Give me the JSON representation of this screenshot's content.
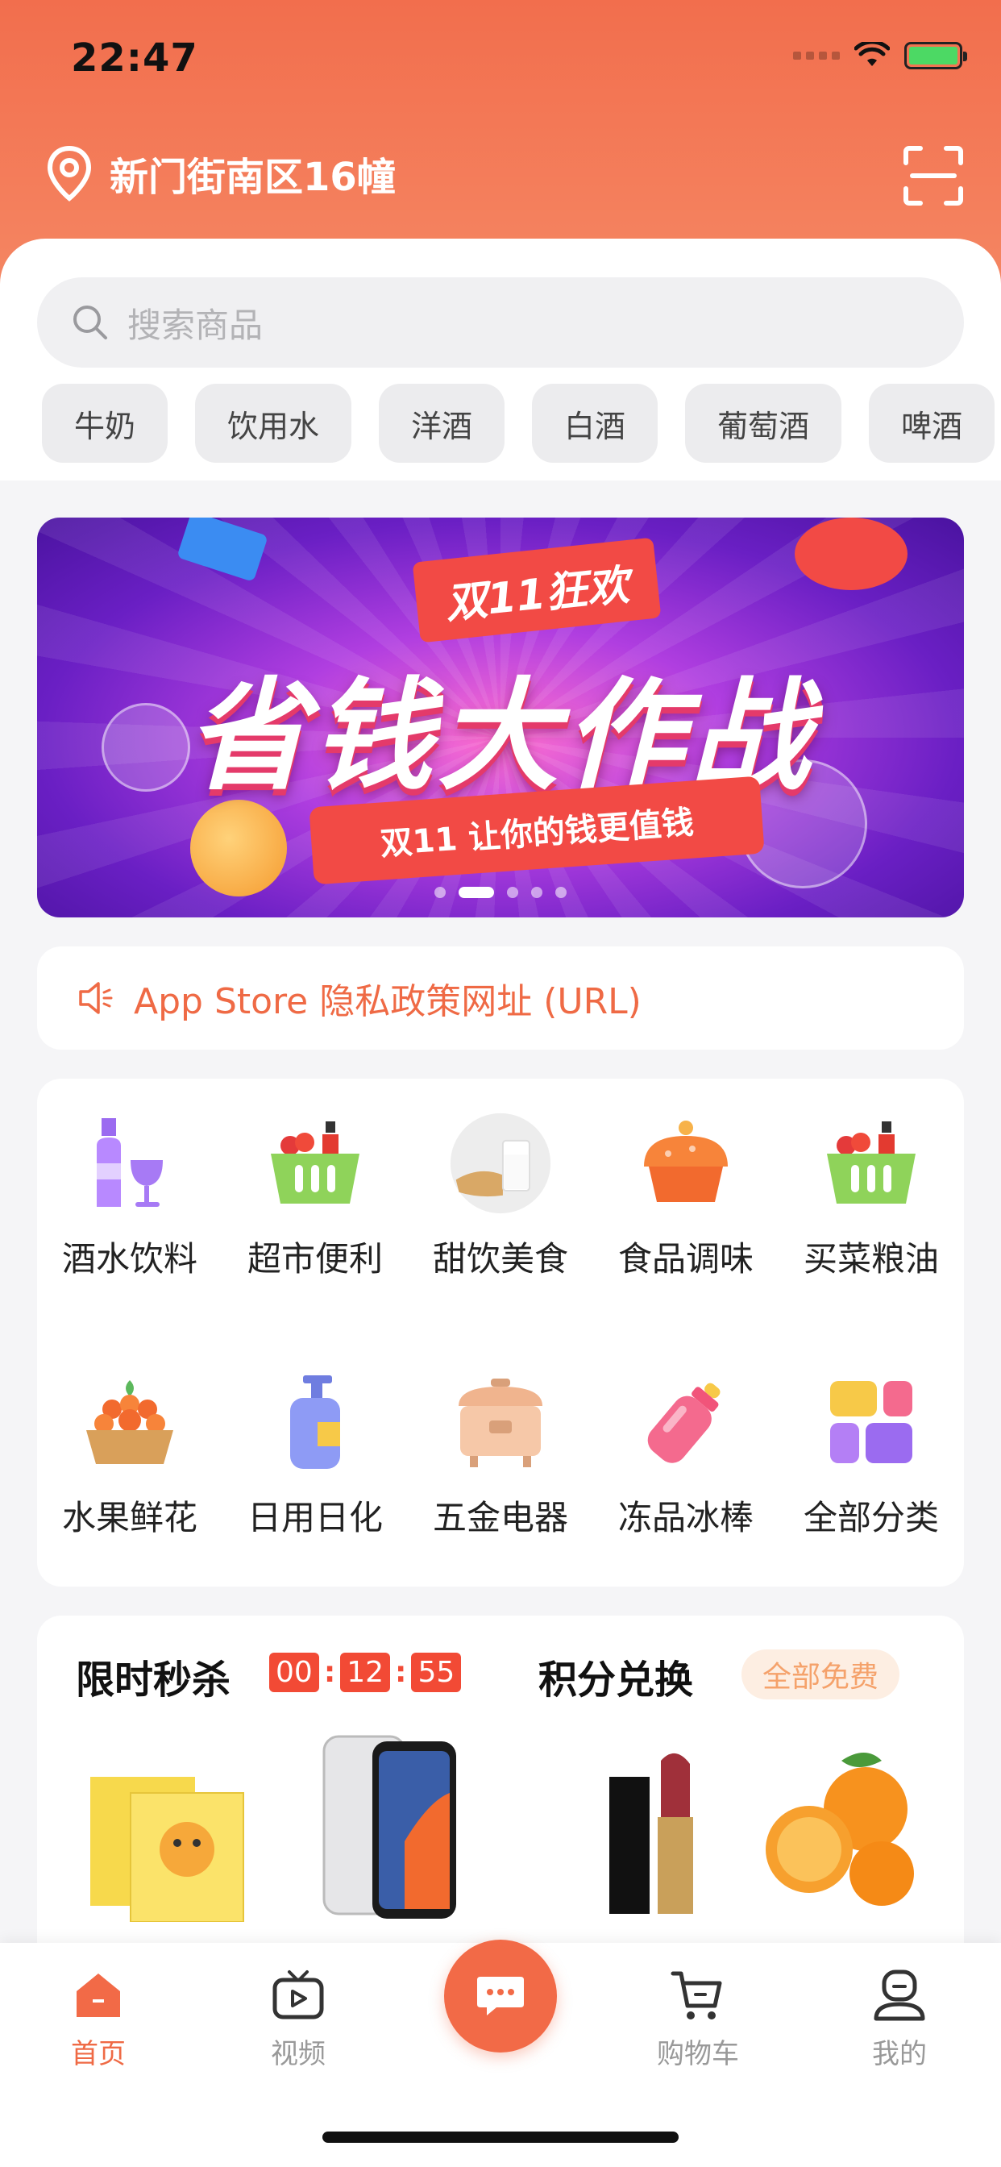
{
  "status_bar": {
    "time": "22:47"
  },
  "header": {
    "location": "新门街南区16幢"
  },
  "search": {
    "placeholder": "搜索商品"
  },
  "tags": [
    "牛奶",
    "饮用水",
    "洋酒",
    "白酒",
    "葡萄酒",
    "啤酒"
  ],
  "banner": {
    "flag_text": "双11狂欢",
    "title": "省钱大作战",
    "ribbon_text": "双11 让你的钱更值钱",
    "active_index": 1,
    "dot_count": 5
  },
  "notice": {
    "text": "App Store 隐私政策网址 (URL)"
  },
  "categories": [
    {
      "label": "酒水饮料",
      "icon": "drinks-icon"
    },
    {
      "label": "超市便利",
      "icon": "basket-icon"
    },
    {
      "label": "甜饮美食",
      "icon": "bread-milk-icon"
    },
    {
      "label": "食品调味",
      "icon": "cake-icon"
    },
    {
      "label": "买菜粮油",
      "icon": "basket-icon"
    },
    {
      "label": "水果鲜花",
      "icon": "fruit-basket-icon"
    },
    {
      "label": "日用日化",
      "icon": "lotion-bottle-icon"
    },
    {
      "label": "五金电器",
      "icon": "rice-cooker-icon"
    },
    {
      "label": "冻品冰棒",
      "icon": "bottle-icon"
    },
    {
      "label": "全部分类",
      "icon": "grid-icon"
    }
  ],
  "flash_sale": {
    "title": "限时秒杀",
    "timer": [
      "00",
      "12",
      "55"
    ]
  },
  "points": {
    "title": "积分兑换",
    "badge": "全部免费"
  },
  "products": [
    "face-mask-product",
    "phone-product",
    "lipstick-product",
    "orange-product"
  ],
  "tabbar": {
    "items": [
      {
        "label": "首页",
        "active": true
      },
      {
        "label": "视频",
        "active": false
      },
      {
        "label": "购物车",
        "active": false
      },
      {
        "label": "我的",
        "active": false
      }
    ]
  },
  "colors": {
    "brand": "#f26e4d",
    "accent_text": "#ef6a45"
  }
}
